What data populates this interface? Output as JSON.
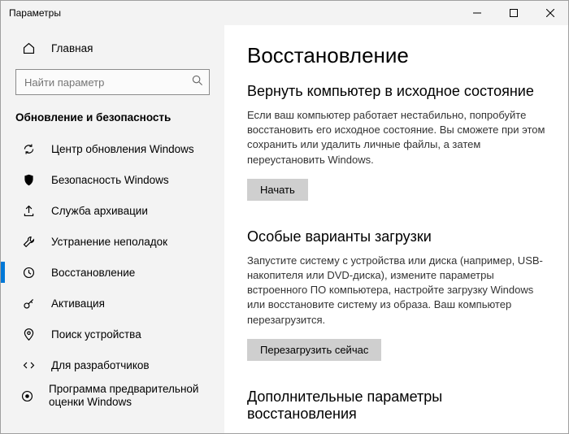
{
  "window": {
    "title": "Параметры"
  },
  "sidebar": {
    "home_label": "Главная",
    "search_placeholder": "Найти параметр",
    "section_header": "Обновление и безопасность",
    "items": [
      {
        "icon": "sync",
        "label": "Центр обновления Windows"
      },
      {
        "icon": "shield",
        "label": "Безопасность Windows"
      },
      {
        "icon": "backup",
        "label": "Служба архивации"
      },
      {
        "icon": "trouble",
        "label": "Устранение неполадок"
      },
      {
        "icon": "recovery",
        "label": "Восстановление",
        "active": true
      },
      {
        "icon": "key",
        "label": "Активация"
      },
      {
        "icon": "find",
        "label": "Поиск устройства"
      },
      {
        "icon": "dev",
        "label": "Для разработчиков"
      },
      {
        "icon": "insider",
        "label": "Программа предварительной оценки Windows"
      }
    ]
  },
  "main": {
    "page_title": "Восстановление",
    "reset": {
      "heading": "Вернуть компьютер в исходное состояние",
      "body": "Если ваш компьютер работает нестабильно, попробуйте восстановить его исходное состояние. Вы сможете при этом сохранить или удалить личные файлы, а затем переустановить Windows.",
      "button": "Начать"
    },
    "advanced": {
      "heading": "Особые варианты загрузки",
      "body": "Запустите систему с устройства или диска (например, USB-накопителя или DVD-диска), измените параметры встроенного ПО компьютера, настройте загрузку Windows или восстановите систему из образа. Ваш компьютер перезагрузится.",
      "button": "Перезагрузить сейчас"
    },
    "more": {
      "heading": "Дополнительные параметры восстановления"
    }
  }
}
